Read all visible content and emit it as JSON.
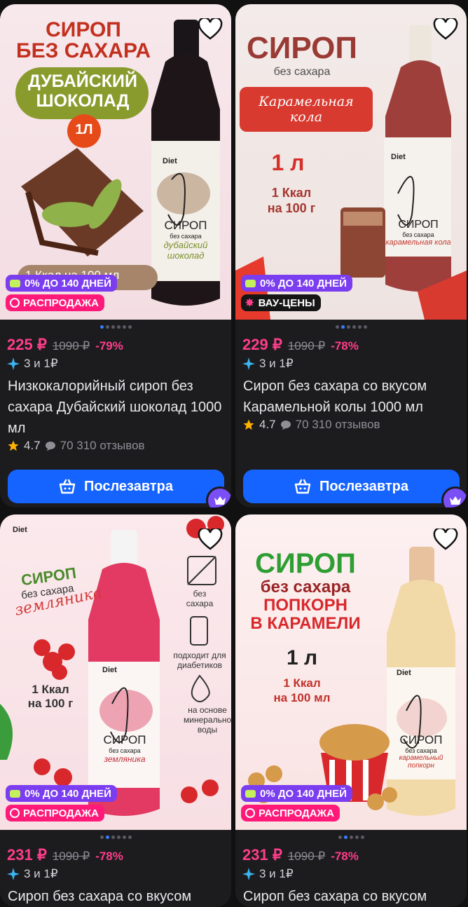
{
  "products": [
    {
      "art": {
        "headline1": "СИРОП",
        "headline2": "БЕЗ САХАРА",
        "pill": "ДУБАЙСКИЙ ШОКОЛАД",
        "volume": "1Л",
        "bottom": "1 Ккал на 100 мл",
        "label_brand": "Diet",
        "label_name": "СИРОП",
        "label_sub": "без сахара",
        "label_flavor": "дубайский шоколад"
      },
      "badges": [
        "0% ДО 140 ДНЕЙ",
        "РАСПРОДАЖА"
      ],
      "price": "225 ₽",
      "old_price": "1090 ₽",
      "discount": "-79%",
      "promo": "3 и 1₽",
      "title": "Низкокалорийный сироп без сахара Дубайский шоколад 1000 мл",
      "rating": "4.7",
      "reviews": "70 310 отзывов",
      "button": "Послезавтра"
    },
    {
      "art": {
        "headline1": "СИРОП",
        "headline2": "без сахара",
        "pill": "Карамельная кола",
        "volume": "1 л",
        "kcal1": "1 Ккал",
        "kcal2": "на 100 г",
        "label_brand": "Diet",
        "label_name": "СИРОП",
        "label_sub": "без сахара",
        "label_flavor": "карамельная кола"
      },
      "badges": [
        "0% ДО 140 ДНЕЙ",
        "ВАУ-ЦЕНЫ"
      ],
      "price": "229 ₽",
      "old_price": "1090 ₽",
      "discount": "-78%",
      "promo": "3 и 1₽",
      "title": "Сироп без сахара со вкусом Карамельной колы 1000 мл",
      "rating": "4.7",
      "reviews": "70 310 отзывов",
      "button": "Послезавтра"
    },
    {
      "art": {
        "brand": "Diet",
        "headline1": "СИРОП",
        "headline2": "без сахара",
        "flavor": "земляника",
        "kcal1": "1 Ккал",
        "kcal2": "на 100 г",
        "feat1": "без сахара",
        "feat2": "подходит для диабетиков",
        "feat3": "на основе минеральной воды",
        "label_brand": "Diet",
        "label_name": "СИРОП",
        "label_sub": "без сахара",
        "label_flavor": "земляника"
      },
      "badges": [
        "0% ДО 140 ДНЕЙ",
        "РАСПРОДАЖА"
      ],
      "price": "231 ₽",
      "old_price": "1090 ₽",
      "discount": "-78%",
      "promo": "3 и 1₽",
      "title": "Сироп без сахара со вкусом"
    },
    {
      "art": {
        "headline1": "СИРОП",
        "headline2": "без сахара",
        "headline3": "ПОПКОРН",
        "headline4": "В КАРАМЕЛИ",
        "volume": "1 л",
        "kcal1": "1 Ккал",
        "kcal2": "на 100 мл",
        "label_brand": "Diet",
        "label_name": "СИРОП",
        "label_sub": "без сахара",
        "label_flavor": "карамельный попкорн"
      },
      "badges": [
        "0% ДО 140 ДНЕЙ",
        "РАСПРОДАЖА"
      ],
      "price": "231 ₽",
      "old_price": "1090 ₽",
      "discount": "-78%",
      "promo": "3 и 1₽",
      "title": "Сироп без сахара со вкусом"
    }
  ]
}
